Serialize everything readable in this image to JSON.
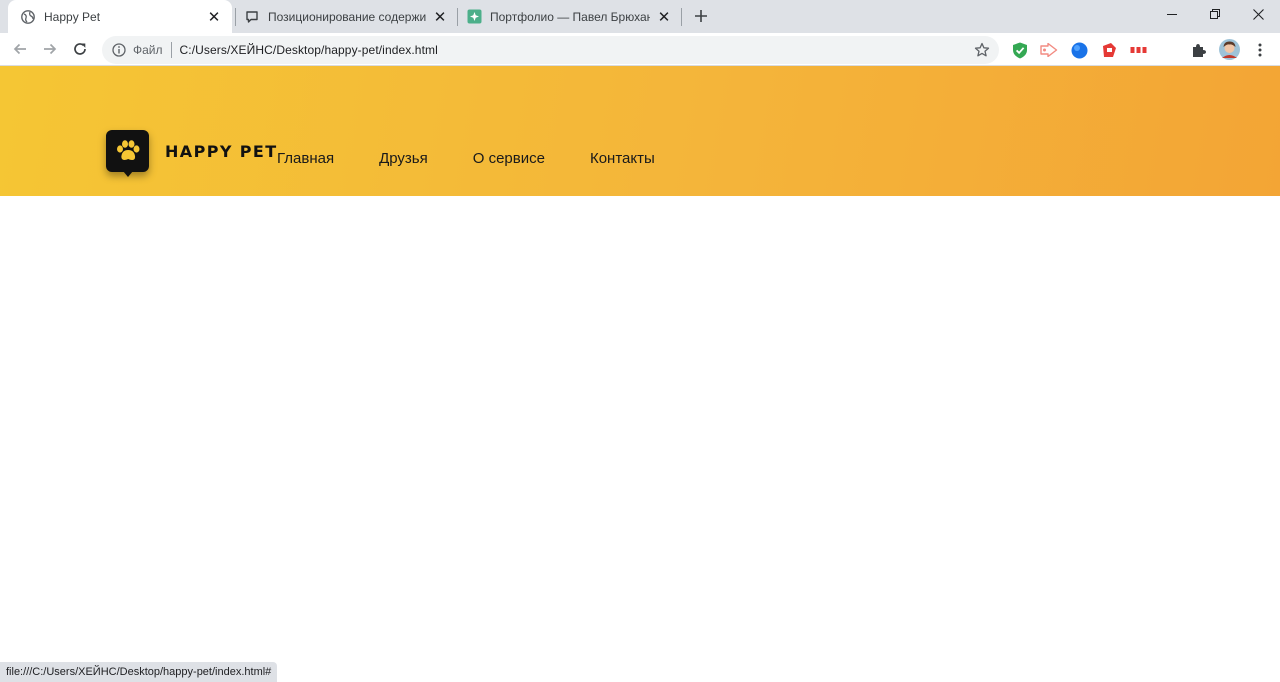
{
  "browser": {
    "tabs": [
      {
        "title": "Happy Pet",
        "icon": "globe-icon",
        "active": true
      },
      {
        "title": "Позиционирование содержимого",
        "icon": "chat-bubble-icon",
        "active": false
      },
      {
        "title": "Портфолио — Павел Брюханов",
        "icon": "portfolio-icon",
        "active": false
      }
    ],
    "address_bar": {
      "scheme_label": "Файл",
      "url": "C:/Users/ХЕЙНС/Desktop/happy-pet/index.html"
    },
    "extensions": [
      "shield-check-icon",
      "arrow-play-icon",
      "blue-circle-icon",
      "red-tag-icon",
      "text-badge-icon",
      "puzzle-icon",
      "avatar"
    ],
    "status_url": "file:///C:/Users/ХЕЙНС/Desktop/happy-pet/index.html#"
  },
  "site": {
    "brand": "HAPPY PET",
    "logo_icon": "paw-icon",
    "nav": [
      "Главная",
      "Друзья",
      "О сервисе",
      "Контакты"
    ],
    "colors": {
      "accent_start": "#f5c634",
      "accent_end": "#f3a535",
      "logo_bg": "#111111",
      "paw": "#f5c634"
    }
  }
}
